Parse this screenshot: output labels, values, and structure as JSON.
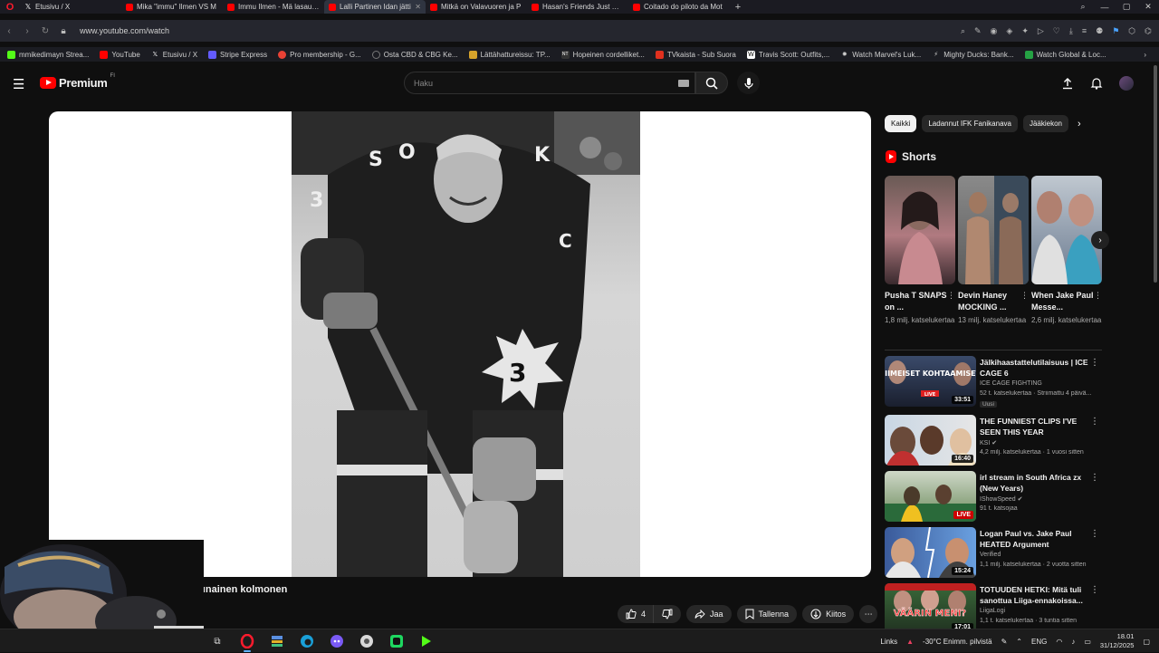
{
  "browser": {
    "tabs": [
      {
        "title": "Etusivu / X",
        "favicon": "x-icon",
        "active": false
      },
      {
        "title": "Mika \"immu\" Ilmen VS M",
        "favicon": "youtube-icon",
        "active": false
      },
      {
        "title": "Immu Ilmen - Mä lasautan",
        "favicon": "youtube-icon",
        "active": false
      },
      {
        "title": "Lalli Partinen Idan jätti",
        "favicon": "youtube-icon",
        "active": true
      },
      {
        "title": "Mitkä on Valavuoren ja P",
        "favicon": "youtube-icon",
        "active": false
      },
      {
        "title": "Hasan's Friends Just Expo",
        "favicon": "youtube-icon",
        "active": false
      },
      {
        "title": "Coitado do piloto da Mot",
        "favicon": "youtube-icon",
        "active": false
      }
    ],
    "url": "www.youtube.com/watch",
    "bookmarks": [
      {
        "label": "mmikedimayn Strea...",
        "color": "#53fc18"
      },
      {
        "label": "YouTube",
        "color": "#ff0000"
      },
      {
        "label": "Etusivu / X",
        "color": "#000000"
      },
      {
        "label": "Stripe Express",
        "color": "#635bff"
      },
      {
        "label": "Pro membership - G...",
        "color": "#e94235"
      },
      {
        "label": "Osta CBD & CBG Ke...",
        "color": "#666666"
      },
      {
        "label": "Lättähattureissu: TP...",
        "color": "#d6a32b"
      },
      {
        "label": "Hopeinen cordelliket...",
        "color": "#222222"
      },
      {
        "label": "TVkaista - Sub Suora",
        "color": "#e0301e"
      },
      {
        "label": "Travis Scott: Outfits,...",
        "color": "#ffffff"
      },
      {
        "label": "Watch Marvel's Luk...",
        "color": "#888888"
      },
      {
        "label": "Mighty Ducks: Bank...",
        "color": "#888888"
      },
      {
        "label": "Watch Global & Loc...",
        "color": "#25a244"
      }
    ]
  },
  "youtube": {
    "logo_text": "Premium",
    "region": "FI",
    "search_placeholder": "Haku",
    "video_title": "ttiläinen ja punainen kolmonen",
    "actions": {
      "like_count": "4",
      "share": "Jaa",
      "save": "Tallenna",
      "thanks": "Kiitos"
    },
    "chips": [
      "Kaikki",
      "Ladannut IFK Fanikanava",
      "Jääkiekon"
    ],
    "shorts_title": "Shorts",
    "shorts": [
      {
        "title": "Pusha T SNAPS on ...",
        "views": "1,8 milj. katselukertaa"
      },
      {
        "title": "Devin Haney MOCKING ...",
        "views": "13 milj. katselukertaa"
      },
      {
        "title": "When Jake Paul Messe...",
        "views": "2,6 milj. katselukertaa"
      }
    ],
    "recommended": [
      {
        "title": "Jälkihaastattelutilaisuus | ICE CAGE 6",
        "channel": "ICE CAGE FIGHTING",
        "meta": "52 t. katselukertaa · Striimattu 4 päivä...",
        "badge": "Uusi",
        "duration": "33:51",
        "overlay": "VIIMEISET KOHTAAMISET",
        "overlay_tag": "LIVE"
      },
      {
        "title": "THE FUNNIEST CLIPS I'VE SEEN THIS YEAR",
        "channel": "KSI",
        "meta": "4,2 milj. katselukertaa · 1 vuosi sitten",
        "badge": "",
        "duration": "16:40",
        "overlay": "",
        "overlay_tag": ""
      },
      {
        "title": "irl stream in South Africa zx (New Years)",
        "channel": "IShowSpeed",
        "meta": "91 t. katsojaa",
        "badge": "",
        "duration": "LIVE",
        "overlay": "",
        "overlay_tag": ""
      },
      {
        "title": "Logan Paul vs. Jake Paul HEATED Argument",
        "channel": "Verified",
        "meta": "1,1 milj. katselukertaa · 2 vuotta sitten",
        "badge": "",
        "duration": "15:24",
        "overlay": "",
        "overlay_tag": ""
      },
      {
        "title": "TOTUUDEN HETKI: Mitä tuli sanottua Liiga-ennakoissa... 😳",
        "channel": "LiigaLogi",
        "meta": "1,1 t. katselukertaa · 3 tuntia sitten",
        "badge": "",
        "duration": "17:01",
        "overlay": "VÄÄRIN MENI?",
        "overlay_tag": ""
      }
    ]
  },
  "taskbar": {
    "links_label": "Links",
    "weather": "-30°C  Enimm. pilvistä",
    "lang": "ENG",
    "time": "18.01",
    "date": "31/12/2025"
  },
  "colors": {
    "youtube_red": "#ff0000",
    "page_bg": "#0f0f0f",
    "chip_bg": "#272727"
  }
}
